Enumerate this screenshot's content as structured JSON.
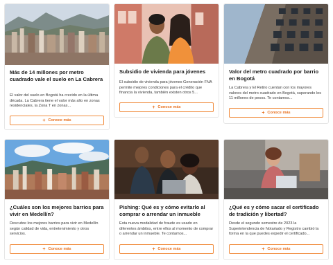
{
  "cards": [
    {
      "title": "Más de 14 millones por metro cuadrado vale el suelo en La Cabrera",
      "description": "El valor del suelo en Bogotá ha crecido en la última década. La Cabrera tiene el valor más alto en zonas residenciales, la Zona T en zonas...",
      "button_label": "Conoce más",
      "button_icon": "+"
    },
    {
      "title": "Subsidio de vivienda para jóvenes",
      "description": "El subsidio de vivienda para jóvenes Generación FNA permite mejores condiciones para el crédito que financia la vivienda, también existen otros 5...",
      "button_label": "Conoce más",
      "button_icon": "+"
    },
    {
      "title": "Valor del metro cuadrado por barrio en Bogotá",
      "description": "La Cabrera y El Retiro cuentan con los mayores valores del metro cuadrado en Bogotá, superando los 11 millones de pesos. Te contamos...",
      "button_label": "Conoce más",
      "button_icon": "+"
    },
    {
      "title": "¿Cuáles son los mejores barrios para vivir en Medellín?",
      "description": "Descubre los mejores barrios para vivir en Medellín según calidad de vida, entretenimiento y otros servicios.",
      "button_label": "Conoce más",
      "button_icon": "+"
    },
    {
      "title": "Pishing: Qué es y cómo evitarlo al comprar o arrendar un inmueble",
      "description": "Esta nueva modalidad de fraude es usado en diferentes ámbitos, entre ellos al momento de comprar o arrendar un inmueble. Te contamos...",
      "button_label": "Conoce más",
      "button_icon": "+"
    },
    {
      "title": "¿Qué es y cómo sacar el certificado de tradición y libertad?",
      "description": "Desde el segundo semestre de 2023 la Superintendencia de Notariado y Registro cambió la forma en la que puedes expedir el certificado...",
      "button_label": "Conoce más",
      "button_icon": "+"
    }
  ],
  "colors": {
    "accent": "#e8711f",
    "accent_border": "#f08a3a"
  }
}
